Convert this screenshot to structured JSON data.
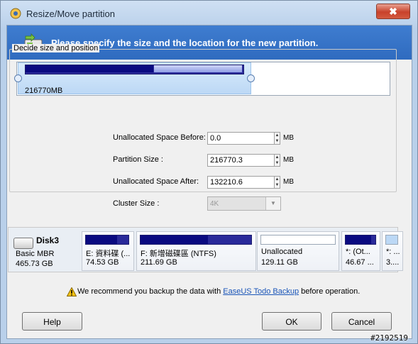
{
  "window": {
    "title": "Resize/Move partition",
    "close_label": "✖"
  },
  "banner": {
    "text": "Please specify the size and the location for the new partition."
  },
  "group": {
    "label": "Decide size and position"
  },
  "map": {
    "size_label": "216770MB",
    "used_fraction": 0.62,
    "selection_fraction": 0.62
  },
  "fields": {
    "before": {
      "label": "Unallocated Space Before:",
      "value": "0.0",
      "unit": "MB"
    },
    "size": {
      "label": "Partition Size :",
      "value": "216770.3",
      "unit": "MB"
    },
    "after": {
      "label": "Unallocated Space After:",
      "value": "132210.6",
      "unit": "MB"
    },
    "cluster": {
      "label": "Cluster Size :",
      "value": "4K"
    }
  },
  "disk": {
    "name": "Disk3",
    "type": "Basic MBR",
    "size": "465.73 GB"
  },
  "partitions": [
    {
      "label": "E: 資料碟 (...",
      "size": "74.53 GB",
      "used_fraction": 0.7
    },
    {
      "label": "F: 新增磁碟區 (NTFS)",
      "size": "211.69 GB",
      "used_fraction": 0.6
    },
    {
      "label": "Unallocated",
      "size": "129.11 GB",
      "used_fraction": 0
    },
    {
      "label": "*: (Ot...",
      "size": "46.67 ...",
      "used_fraction": 0.9
    },
    {
      "label": "*: ...",
      "size": "3....",
      "used_fraction": 0.5
    }
  ],
  "notice": {
    "pre": "We recommend you backup the data with ",
    "link": "EaseUS Todo Backup",
    "post": " before operation."
  },
  "buttons": {
    "help": "Help",
    "ok": "OK",
    "cancel": "Cancel"
  },
  "stamp": "#2192519",
  "colors": {
    "banner": "#2f6bbf",
    "bar_used": "#0a0a80",
    "link": "#1a55b8"
  }
}
